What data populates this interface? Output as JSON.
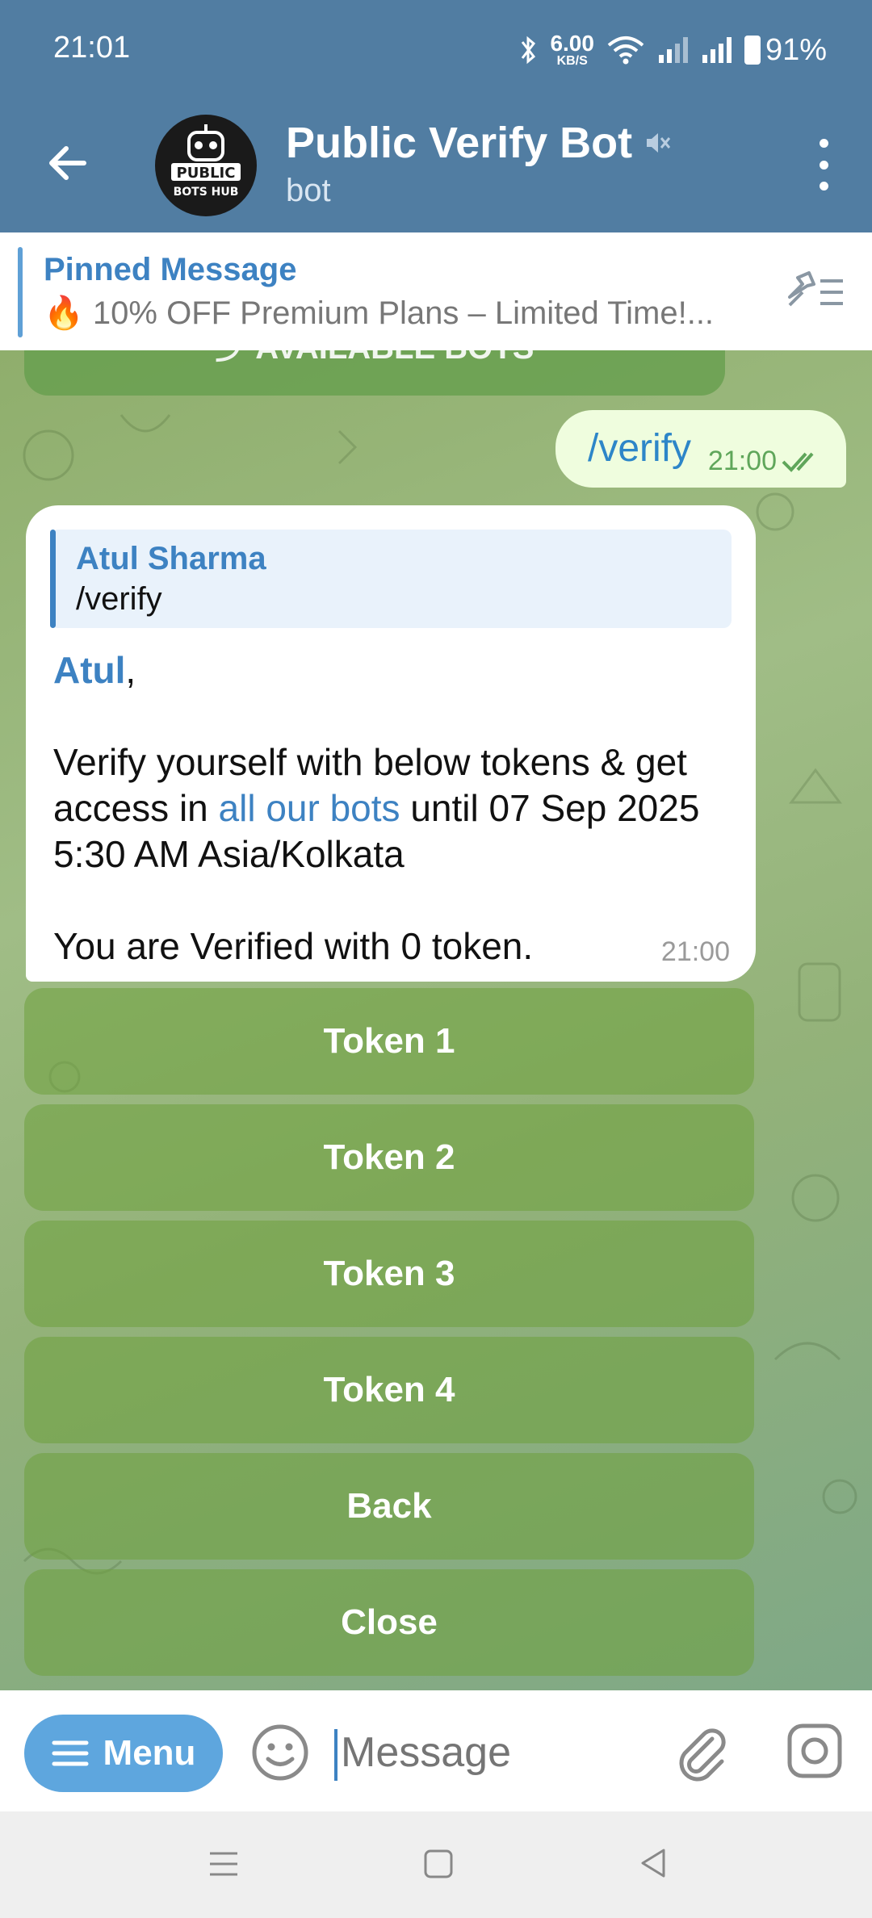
{
  "status": {
    "time": "21:01",
    "speed_value": "6.00",
    "speed_unit": "KB/S",
    "battery": "91%"
  },
  "header": {
    "title": "Public Verify Bot",
    "subtitle": "bot",
    "avatar_text_1": "PUBLIC",
    "avatar_text_2": "BOTS HUB"
  },
  "pinned": {
    "title": "Pinned Message",
    "text": "🔥 10% OFF Premium Plans – Limited Time!..."
  },
  "chat": {
    "outgoing": {
      "text": "/verify",
      "time": "21:00"
    },
    "incoming": {
      "quote_name": "Atul Sharma",
      "quote_text": "/verify",
      "mention": "Atul",
      "line1": "Verify yourself with below tokens & get access in ",
      "link": "all our bots",
      "line2": " until 07 Sep 2025 5:30 AM Asia/Kolkata",
      "status": "You are Verified with 0 token.",
      "time": "21:00"
    },
    "buttons": [
      "Token 1",
      "Token 2",
      "Token 3",
      "Token 4",
      "Back",
      "Close"
    ]
  },
  "input": {
    "menu_label": "Menu",
    "placeholder": "Message"
  },
  "colors": {
    "header": "#517da2",
    "accent": "#3d82c2",
    "outgoing_bubble": "#effdde",
    "menu_button": "#5ea6de"
  }
}
